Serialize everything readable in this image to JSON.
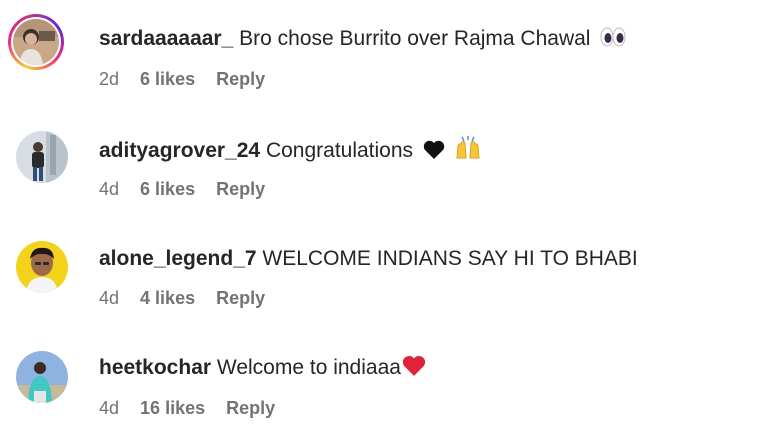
{
  "comments": [
    {
      "username": "sardaaaaaar_",
      "text": "Bro chose Burrito over Rajma Chawal",
      "emoji": "eyes-emoji",
      "time": "2d",
      "likes": "6 likes",
      "reply": "Reply",
      "has_story_ring": true
    },
    {
      "username": "adityagrover_24",
      "text": "Congratulations",
      "emoji": "black-heart-and-raised-hands-emoji",
      "time": "4d",
      "likes": "6 likes",
      "reply": "Reply",
      "has_story_ring": false
    },
    {
      "username": "alone_legend_7",
      "text": "WELCOME INDIANS SAY HI TO BHABI",
      "emoji": "",
      "time": "4d",
      "likes": "4 likes",
      "reply": "Reply",
      "has_story_ring": false
    },
    {
      "username": "heetkochar",
      "text": "Welcome to indiaaa",
      "emoji": "red-heart-emoji",
      "time": "4d",
      "likes": "16 likes",
      "reply": "Reply",
      "has_story_ring": false
    }
  ]
}
